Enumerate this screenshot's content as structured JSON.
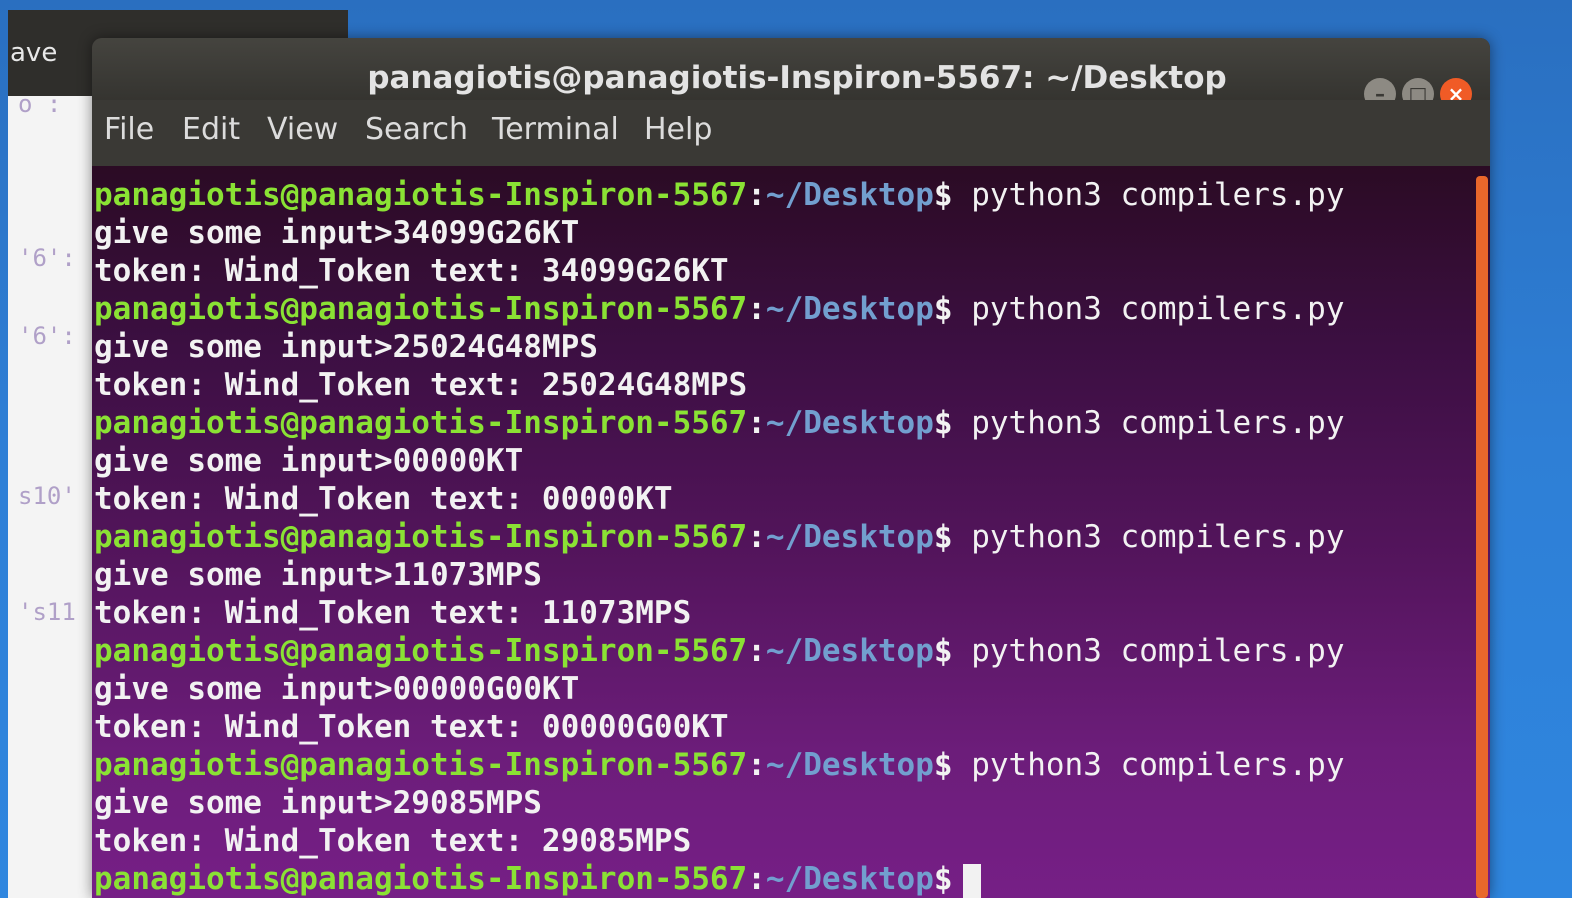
{
  "background_window": {
    "title": "ave",
    "snippets": [
      "o :",
      "'6':",
      "'6':",
      "s10'",
      "'s11"
    ]
  },
  "terminal": {
    "title": "panagiotis@panagiotis-Inspiron-5567: ~/Desktop",
    "buttons": {
      "minimize": "–",
      "maximize": "□",
      "close": "×"
    },
    "menu": [
      "File",
      "Edit",
      "View",
      "Search",
      "Terminal",
      "Help"
    ],
    "prompt": {
      "user": "panagiotis@panagiotis-Inspiron-5567",
      "colon": ":",
      "path": "~/Desktop",
      "dollar": "$"
    },
    "sessions": [
      {
        "command": "python3 compilers.py",
        "input_line": "give some input>34099G26KT",
        "token_line": "token: Wind_Token text: 34099G26KT"
      },
      {
        "command": "python3 compilers.py",
        "input_line": "give some input>25024G48MPS",
        "token_line": "token: Wind_Token text: 25024G48MPS"
      },
      {
        "command": "python3 compilers.py",
        "input_line": "give some input>00000KT",
        "token_line": "token: Wind_Token text: 00000KT"
      },
      {
        "command": "python3 compilers.py",
        "input_line": "give some input>11073MPS",
        "token_line": "token: Wind_Token text: 11073MPS"
      },
      {
        "command": "python3 compilers.py",
        "input_line": "give some input>00000G00KT",
        "token_line": "token: Wind_Token text: 00000G00KT"
      },
      {
        "command": "python3 compilers.py",
        "input_line": "give some input>29085MPS",
        "token_line": "token: Wind_Token text: 29085MPS"
      }
    ],
    "colors": {
      "user": "#8ae234",
      "path": "#729fcf",
      "text": "#f2f2f2",
      "close_button": "#f05b26",
      "scrollbar": "#e9672b"
    }
  }
}
